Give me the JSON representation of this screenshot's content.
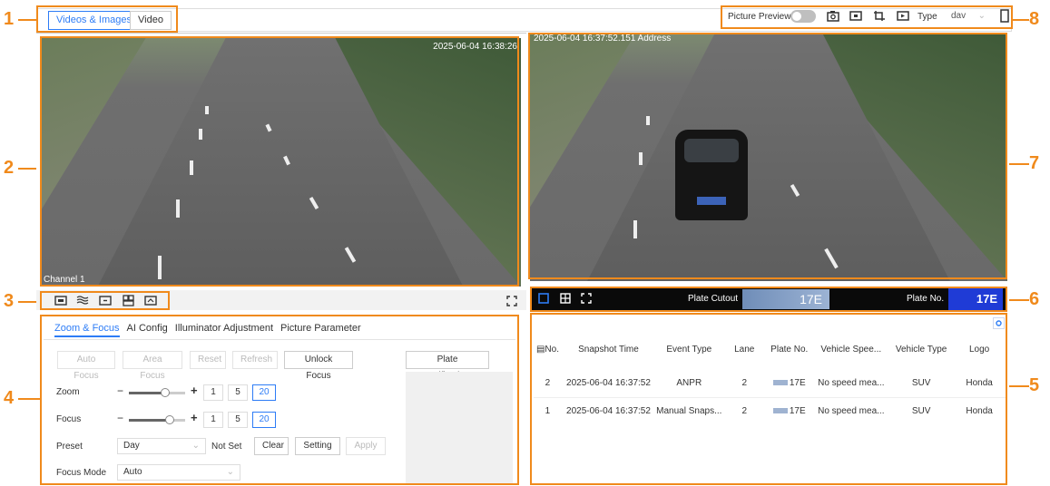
{
  "callouts": [
    "1",
    "2",
    "3",
    "4",
    "5",
    "6",
    "7",
    "8"
  ],
  "topbar": {
    "tab_videos_images": "Videos & Images",
    "tab_video": "Video",
    "picture_preview_label": "Picture Preview",
    "type_label": "Type",
    "type_value": "dav"
  },
  "left_video": {
    "channel_label": "Channel 1",
    "timestamp": "2025-06-04 16:38:26"
  },
  "right_video": {
    "overlay_text": "2025-06-04 16:37:52.151 Address"
  },
  "plate_bar": {
    "plate_cutout_label": "Plate Cutout",
    "plate_cutout_text": "17E",
    "plate_no_label": "Plate No.",
    "plate_no_value": "17E"
  },
  "config_tabs": [
    "Zoom & Focus",
    "AI Config",
    "Illuminator Adjustment",
    "Picture Parameter"
  ],
  "buttons": {
    "auto_focus": "Auto Focus",
    "area_focus": "Area Focus",
    "reset": "Reset",
    "refresh": "Refresh",
    "unlock_focus": "Unlock Focus",
    "plate_verification": "Plate Verification",
    "clear": "Clear",
    "setting": "Setting",
    "apply": "Apply"
  },
  "zoom": {
    "label": "Zoom",
    "steps": [
      "1",
      "5",
      "20"
    ],
    "selected": "20",
    "level": 0.65
  },
  "focus": {
    "label": "Focus",
    "steps": [
      "1",
      "5",
      "20"
    ],
    "selected": "20",
    "level": 0.72
  },
  "preset": {
    "label": "Preset",
    "value": "Day",
    "status": "Not Set"
  },
  "focus_mode": {
    "label": "Focus Mode",
    "value": "Auto"
  },
  "table": {
    "headers": [
      "No.",
      "Snapshot Time",
      "Event Type",
      "Lane",
      "Plate No.",
      "Vehicle Spee...",
      "Vehicle Type",
      "Logo"
    ],
    "rows": [
      [
        "2",
        "2025-06-04 16:37:52",
        "ANPR",
        "2",
        "17E",
        "No speed mea...",
        "SUV",
        "Honda"
      ],
      [
        "1",
        "2025-06-04 16:37:52",
        "Manual Snaps...",
        "2",
        "17E",
        "No speed mea...",
        "SUV",
        "Honda"
      ]
    ]
  },
  "colors": {
    "accent": "#2d7cf6",
    "callout": "#f08a1c",
    "plate_blue": "#1f3bd6"
  }
}
